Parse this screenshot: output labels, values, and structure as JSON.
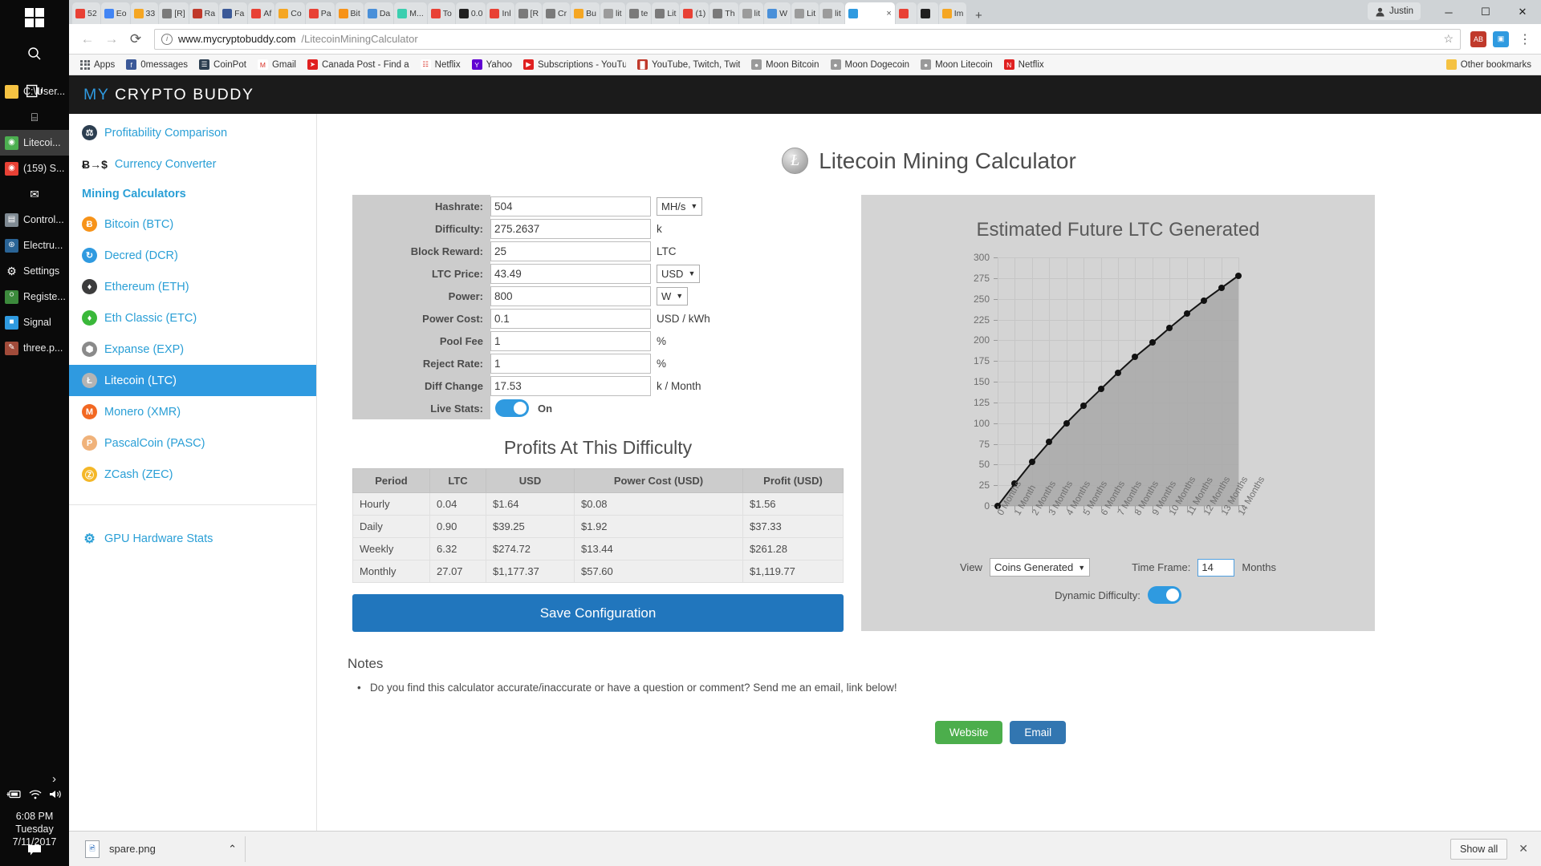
{
  "taskbar": {
    "items": [
      {
        "label": "C:\\User...",
        "icon": "folder-icon",
        "color": "#f5c242",
        "glyph": "",
        "active": false
      },
      {
        "label": "",
        "icon": "store-icon",
        "color": "transparent",
        "glyph": "⌸",
        "active": false
      },
      {
        "label": "Litecoi...",
        "icon": "chrome-icon",
        "color": "#4caf50",
        "glyph": "◉",
        "active": true
      },
      {
        "label": "(159) S...",
        "icon": "chrome-icon",
        "color": "#e84135",
        "glyph": "◉",
        "active": false
      },
      {
        "label": "",
        "icon": "mail-icon",
        "color": "transparent",
        "glyph": "✉",
        "active": false
      },
      {
        "label": "Control...",
        "icon": "control-panel-icon",
        "color": "#7f8a93",
        "glyph": "▤",
        "active": false
      },
      {
        "label": "Electru...",
        "icon": "electrum-icon",
        "color": "#2a6496",
        "glyph": "⊛",
        "active": false
      },
      {
        "label": "Settings",
        "icon": "gear-icon",
        "color": "transparent",
        "glyph": "⚙",
        "active": false
      },
      {
        "label": "Registe...",
        "icon": "globe-icon",
        "color": "#3c8a3c",
        "glyph": "ᴼ",
        "active": false
      },
      {
        "label": "Signal",
        "icon": "signal-icon",
        "color": "#2f9ae0",
        "glyph": "■",
        "active": false
      },
      {
        "label": "three.p...",
        "icon": "paint-icon",
        "color": "#a14b3a",
        "glyph": "✎",
        "active": false
      }
    ],
    "tray": {
      "chevron": "›",
      "battery_icon": "battery-charging-icon",
      "wifi_icon": "wifi-icon",
      "volume_icon": "volume-icon",
      "time": "6:08 PM",
      "day": "Tuesday",
      "date": "7/11/2017",
      "notification_icon": "notification-icon"
    }
  },
  "browser": {
    "tabs": [
      {
        "label": "52",
        "color": "#e84135"
      },
      {
        "label": "Eo",
        "color": "#4285f4"
      },
      {
        "label": "33",
        "color": "#f5a623"
      },
      {
        "label": "[R]",
        "color": "#7a7a7a"
      },
      {
        "label": "Ra",
        "color": "#c0392b"
      },
      {
        "label": "Fa",
        "color": "#3b5998"
      },
      {
        "label": "Af",
        "color": "#e84135"
      },
      {
        "label": "Co",
        "color": "#f5a623"
      },
      {
        "label": "Pa",
        "color": "#e84135"
      },
      {
        "label": "Bit",
        "color": "#f79319"
      },
      {
        "label": "Da",
        "color": "#4a90d9"
      },
      {
        "label": "M...",
        "color": "#3ccfb0"
      },
      {
        "label": "To",
        "color": "#e84135"
      },
      {
        "label": "0.0",
        "color": "#202020"
      },
      {
        "label": "Inl",
        "color": "#e84135"
      },
      {
        "label": "[R",
        "color": "#7a7a7a"
      },
      {
        "label": "Cr",
        "color": "#7a7a7a"
      },
      {
        "label": "Bu",
        "color": "#f5a623"
      },
      {
        "label": "lit",
        "color": "#9b9b9b"
      },
      {
        "label": "te",
        "color": "#7a7a7a"
      },
      {
        "label": "Lit",
        "color": "#7a7a7a"
      },
      {
        "label": "(1)",
        "color": "#e84135"
      },
      {
        "label": "Th",
        "color": "#7a7a7a"
      },
      {
        "label": "lit",
        "color": "#9b9b9b"
      },
      {
        "label": "W",
        "color": "#4a90d9"
      },
      {
        "label": "Lit",
        "color": "#9b9b9b"
      },
      {
        "label": "lit",
        "color": "#9b9b9b"
      },
      {
        "label": "x",
        "color": "#2f9ae0"
      },
      {
        "label": "",
        "color": "#e84135"
      },
      {
        "label": "",
        "color": "#202020"
      },
      {
        "label": "Im",
        "color": "#f5a623"
      }
    ],
    "new_tab_label": "+",
    "user_chip": "Justin",
    "window_controls": {
      "minimize": "─",
      "maximize": "☐",
      "close": "✕"
    },
    "back_label": "←",
    "forward_label": "→",
    "reload_label": "⟳",
    "url_domain": "www.mycryptobuddy.com",
    "url_path": "/LitecoinMiningCalculator",
    "star_label": "☆",
    "extensions": [
      {
        "name": "adblock-extension-icon",
        "color": "#c0392b",
        "glyph": "AB"
      },
      {
        "name": "puzzle-extension-icon",
        "color": "#2f9ae0",
        "glyph": "▣"
      }
    ],
    "menu_label": "⋮",
    "bookmarks": [
      {
        "label": "Apps",
        "icon": "apps-grid-icon",
        "color": "grid"
      },
      {
        "label": "0messages",
        "icon": "facebook-icon",
        "color": "#3b5998",
        "glyph": "f"
      },
      {
        "label": "CoinPot",
        "icon": "coinpot-icon",
        "color": "#2c3e50",
        "glyph": "☰"
      },
      {
        "label": "Gmail",
        "icon": "gmail-icon",
        "color": "#ffffff",
        "glyph": "M"
      },
      {
        "label": "Canada Post - Find a",
        "icon": "canadapost-icon",
        "color": "#e02020",
        "glyph": "➤"
      },
      {
        "label": "Netflix",
        "icon": "page-icon",
        "color": "#ffffff",
        "glyph": "☷"
      },
      {
        "label": "Yahoo",
        "icon": "yahoo-icon",
        "color": "#6001d2",
        "glyph": "Y"
      },
      {
        "label": "Subscriptions - YouTu",
        "icon": "youtube-icon",
        "color": "#e02020",
        "glyph": "▶"
      },
      {
        "label": "YouTube, Twitch, Twit",
        "icon": "chart-icon",
        "color": "#c0392b",
        "glyph": "█"
      },
      {
        "label": "Moon Bitcoin",
        "icon": "moon-icon",
        "color": "#9a9a9a",
        "glyph": "●"
      },
      {
        "label": "Moon Dogecoin",
        "icon": "moon-icon",
        "color": "#9a9a9a",
        "glyph": "●"
      },
      {
        "label": "Moon Litecoin",
        "icon": "moon-icon",
        "color": "#9a9a9a",
        "glyph": "●"
      },
      {
        "label": "Netflix",
        "icon": "netflix-icon",
        "color": "#e02020",
        "glyph": "N"
      }
    ],
    "other_bookmarks": "Other bookmarks",
    "other_bookmarks_icon": "folder-icon"
  },
  "site": {
    "brand_my": "MY",
    "brand_rest": "CRYPTO BUDDY",
    "page_title": "Litecoin Mining Calculator",
    "page_title_icon": "litecoin-coin-icon"
  },
  "sidebar": {
    "top_items": [
      {
        "label": "Profitability Comparison",
        "icon": "scales-icon",
        "color": "#2c3e50",
        "glyph": "⚖"
      },
      {
        "label": "Currency Converter",
        "icon": "currency-converter-icon",
        "color": "transparent",
        "glyph": "Ƀ→$"
      }
    ],
    "heading": "Mining Calculators",
    "coins": [
      {
        "label": "Bitcoin (BTC)",
        "icon": "bitcoin-icon",
        "color": "#f79319",
        "glyph": "Ƀ",
        "active": false
      },
      {
        "label": "Decred (DCR)",
        "icon": "decred-icon",
        "color": "#2f9ae0",
        "glyph": "↻",
        "active": false
      },
      {
        "label": "Ethereum (ETH)",
        "icon": "ethereum-icon",
        "color": "#3c3c3d",
        "glyph": "♦",
        "active": false
      },
      {
        "label": "Eth Classic (ETC)",
        "icon": "eth-classic-icon",
        "color": "#3ab83a",
        "glyph": "♦",
        "active": false
      },
      {
        "label": "Expanse (EXP)",
        "icon": "expanse-icon",
        "color": "#8a8a8a",
        "glyph": "⬢",
        "active": false
      },
      {
        "label": "Litecoin (LTC)",
        "icon": "litecoin-icon",
        "color": "#b4b4b4",
        "glyph": "Ł",
        "active": true
      },
      {
        "label": "Monero (XMR)",
        "icon": "monero-icon",
        "color": "#f26822",
        "glyph": "M",
        "active": false
      },
      {
        "label": "PascalCoin (PASC)",
        "icon": "pascalcoin-icon",
        "color": "#f0b27a",
        "glyph": "P",
        "active": false
      },
      {
        "label": "ZCash (ZEC)",
        "icon": "zcash-icon",
        "color": "#f4b728",
        "glyph": "Ⓩ",
        "active": false
      }
    ],
    "footer_item": {
      "label": "GPU Hardware Stats",
      "icon": "gear-icon",
      "glyph": "⚙"
    }
  },
  "calculator": {
    "fields": [
      {
        "label": "Hashrate:",
        "value": "504",
        "unit_type": "select",
        "unit": "MH/s"
      },
      {
        "label": "Difficulty:",
        "value": "275.2637",
        "unit_type": "text",
        "unit": "k"
      },
      {
        "label": "Block Reward:",
        "value": "25",
        "unit_type": "text",
        "unit": "LTC"
      },
      {
        "label": "LTC Price:",
        "value": "43.49",
        "unit_type": "select",
        "unit": "USD"
      },
      {
        "label": "Power:",
        "value": "800",
        "unit_type": "select",
        "unit": "W"
      },
      {
        "label": "Power Cost:",
        "value": "0.1",
        "unit_type": "text",
        "unit": "USD / kWh"
      },
      {
        "label": "Pool Fee",
        "value": "1",
        "unit_type": "text",
        "unit": "%"
      },
      {
        "label": "Reject Rate:",
        "value": "1",
        "unit_type": "text",
        "unit": "%"
      },
      {
        "label": "Diff Change",
        "value": "17.53",
        "unit_type": "text",
        "unit": "k / Month"
      }
    ],
    "live_stats_label": "Live Stats:",
    "live_stats_state": "On",
    "save_label": "Save Configuration"
  },
  "profits": {
    "title": "Profits At This Difficulty",
    "columns": [
      "Period",
      "LTC",
      "USD",
      "Power Cost (USD)",
      "Profit (USD)"
    ],
    "rows": [
      [
        "Hourly",
        "0.04",
        "$1.64",
        "$0.08",
        "$1.56"
      ],
      [
        "Daily",
        "0.90",
        "$39.25",
        "$1.92",
        "$37.33"
      ],
      [
        "Weekly",
        "6.32",
        "$274.72",
        "$13.44",
        "$261.28"
      ],
      [
        "Monthly",
        "27.07",
        "$1,177.37",
        "$57.60",
        "$1,119.77"
      ]
    ]
  },
  "chart_data": {
    "type": "line",
    "title": "Estimated Future LTC Generated",
    "xlabel": "",
    "ylabel": "",
    "grid": true,
    "legend": "none",
    "xlim": [
      0,
      14
    ],
    "ylim": [
      0,
      300
    ],
    "yticks": [
      0,
      25,
      50,
      75,
      100,
      125,
      150,
      175,
      200,
      225,
      250,
      275,
      300
    ],
    "categories": [
      "0 Months",
      "1 Month",
      "2 Months",
      "3 Months",
      "4 Months",
      "5 Months",
      "6 Months",
      "7 Months",
      "8 Months",
      "9 Months",
      "10 Months",
      "11 Months",
      "12 Months",
      "13 Months",
      "14 Months"
    ],
    "x": [
      0,
      1,
      2,
      3,
      4,
      5,
      6,
      7,
      8,
      9,
      10,
      11,
      12,
      13,
      14
    ],
    "values": [
      0,
      27,
      53,
      77,
      100,
      121,
      141,
      161,
      180,
      197,
      215,
      232,
      248,
      263,
      278
    ],
    "series": [
      {
        "name": "Coins Generated",
        "values": [
          0,
          27,
          53,
          77,
          100,
          121,
          141,
          161,
          180,
          197,
          215,
          232,
          248,
          263,
          278
        ]
      }
    ],
    "area_fill": true
  },
  "chart_controls": {
    "view_label": "View",
    "view_value": "Coins Generated",
    "time_frame_label": "Time Frame:",
    "time_frame_value": "14",
    "time_frame_unit": "Months",
    "dynamic_difficulty_label": "Dynamic Difficulty:",
    "dynamic_difficulty_state": "on"
  },
  "notes": {
    "heading": "Notes",
    "items": [
      "Do you find this calculator accurate/inaccurate or have a question or comment? Send me an email, link below!"
    ],
    "website_label": "Website",
    "email_label": "Email"
  },
  "download_shelf": {
    "file_name": "spare.png",
    "file_icon": "image-file-icon",
    "menu_label": "⌃",
    "show_all_label": "Show all",
    "close_label": "✕"
  }
}
